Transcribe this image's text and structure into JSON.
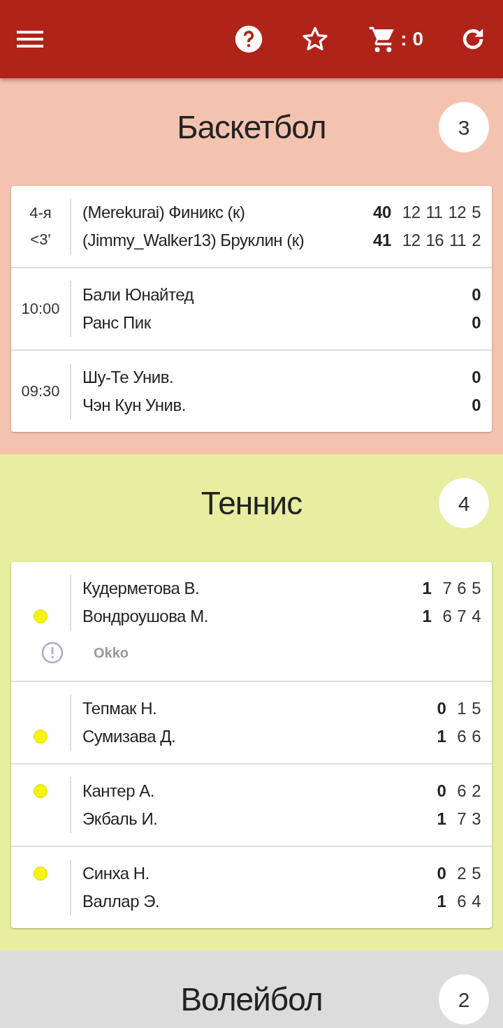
{
  "toolbar": {
    "cart_count": ": 0"
  },
  "sections": [
    {
      "title": "Баскетбол",
      "count": "3",
      "color": "#f4c3b0",
      "matches": [
        {
          "status": [
            "4-я",
            "<3'"
          ],
          "teams": [
            {
              "name": "(Merekurai) Финикс (к)",
              "score": "40",
              "periods": [
                "12",
                "11",
                "12",
                "5"
              ]
            },
            {
              "name": "(Jimmy_Walker13) Бруклин (к)",
              "score": "41",
              "periods": [
                "12",
                "16",
                "11",
                "2"
              ]
            }
          ]
        },
        {
          "status": [
            "10:00"
          ],
          "teams": [
            {
              "name": "Бали Юнайтед",
              "score": "0"
            },
            {
              "name": "Ранс Пик",
              "score": "0"
            }
          ]
        },
        {
          "status": [
            "09:30"
          ],
          "teams": [
            {
              "name": "Шу-Те Унив.",
              "score": "0"
            },
            {
              "name": "Чэн Кун Унив.",
              "score": "0"
            }
          ]
        }
      ]
    },
    {
      "title": "Теннис",
      "count": "4",
      "color": "#e6ee9f",
      "matches": [
        {
          "teams": [
            {
              "name": "Кудерметова В.",
              "score": "1",
              "periods": [
                "7",
                "6",
                "5"
              ],
              "serving": false
            },
            {
              "name": "Вондроушова М.",
              "score": "1",
              "periods": [
                "6",
                "7",
                "4"
              ],
              "serving": true
            }
          ],
          "broadcast": "Okko"
        },
        {
          "teams": [
            {
              "name": "Тепмак Н.",
              "score": "0",
              "periods": [
                "1",
                "5"
              ],
              "serving": false
            },
            {
              "name": "Сумизава Д.",
              "score": "1",
              "periods": [
                "6",
                "6"
              ],
              "serving": true
            }
          ]
        },
        {
          "teams": [
            {
              "name": "Кантер А.",
              "score": "0",
              "periods": [
                "6",
                "2"
              ],
              "serving": true
            },
            {
              "name": "Экбаль И.",
              "score": "1",
              "periods": [
                "7",
                "3"
              ],
              "serving": false
            }
          ]
        },
        {
          "teams": [
            {
              "name": "Синха Н.",
              "score": "0",
              "periods": [
                "2",
                "5"
              ],
              "serving": true
            },
            {
              "name": "Валлар Э.",
              "score": "1",
              "periods": [
                "6",
                "4"
              ],
              "serving": false
            }
          ]
        }
      ]
    },
    {
      "title": "Волейбол",
      "count": "2",
      "color": "#dcdcdc"
    }
  ]
}
